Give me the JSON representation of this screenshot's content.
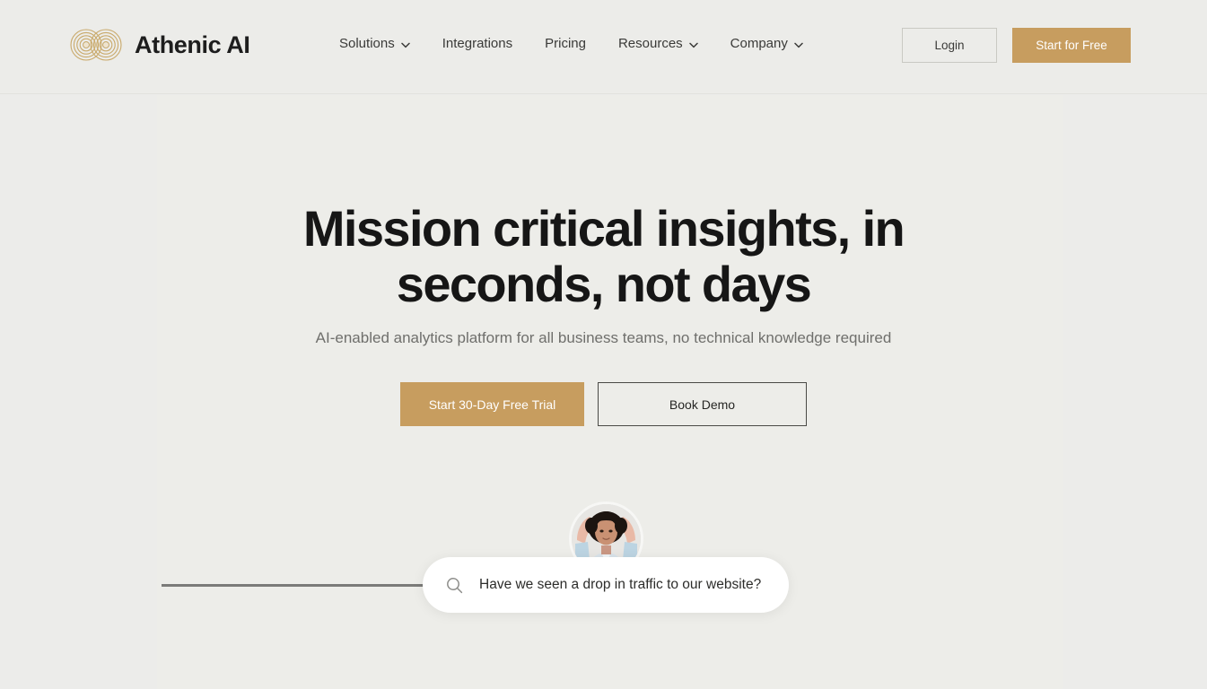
{
  "brand": {
    "name": "Athenic AI",
    "logo_icon": "infinity-rings-logo",
    "logo_color": "#c9a96a"
  },
  "header": {
    "nav_items": [
      {
        "label": "Solutions",
        "has_dropdown": true,
        "icon": "chevron-down-icon"
      },
      {
        "label": "Integrations",
        "has_dropdown": false,
        "icon": ""
      },
      {
        "label": "Pricing",
        "has_dropdown": false,
        "icon": ""
      },
      {
        "label": "Resources",
        "has_dropdown": true,
        "icon": "chevron-down-icon"
      },
      {
        "label": "Company",
        "has_dropdown": true,
        "icon": "chevron-down-icon"
      }
    ],
    "login_label": "Login",
    "start_free_label": "Start for Free",
    "accent_color": "#c79d5f"
  },
  "hero": {
    "headline": "Mission critical insights, in seconds, not days",
    "subheadline": "AI-enabled analytics platform for all business teams, no technical knowledge required",
    "primary_cta": "Start 30-Day Free Trial",
    "secondary_cta": "Book Demo"
  },
  "demo": {
    "avatar_icon": "user-avatar-photo",
    "search_icon": "search-icon",
    "query_text": "Have we seen a drop in traffic to our website?"
  }
}
